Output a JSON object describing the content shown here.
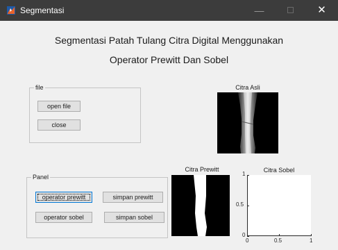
{
  "window": {
    "title": "Segmentasi",
    "minimize_glyph": "—",
    "close_glyph": "✕",
    "icon": "matlab-icon"
  },
  "heading": {
    "line1": "Segmentasi Patah Tulang Citra Digital Menggunakan",
    "line2": "Operator Prewitt Dan Sobel"
  },
  "file_group": {
    "title": "file",
    "open_label": "open file",
    "close_label": "close"
  },
  "panel_group": {
    "title": "Panel",
    "prewitt_label": "operator prewitt",
    "save_prewitt_label": "simpan prewitt",
    "sobel_label": "operator sobel",
    "save_sobel_label": "simpan sobel"
  },
  "axes": {
    "original_title": "Citra Asli",
    "prewitt_title": "Citra Prewitt",
    "sobel_title": "Citra Sobel"
  },
  "chart_data": {
    "type": "scatter",
    "title": "Citra Sobel",
    "xlabel": "",
    "ylabel": "",
    "xlim": [
      0,
      1
    ],
    "ylim": [
      0,
      1
    ],
    "x_ticks": [
      "0",
      "0.5",
      "1"
    ],
    "y_ticks": [
      "0",
      "0.5",
      "1"
    ],
    "series": [],
    "grid": false
  }
}
